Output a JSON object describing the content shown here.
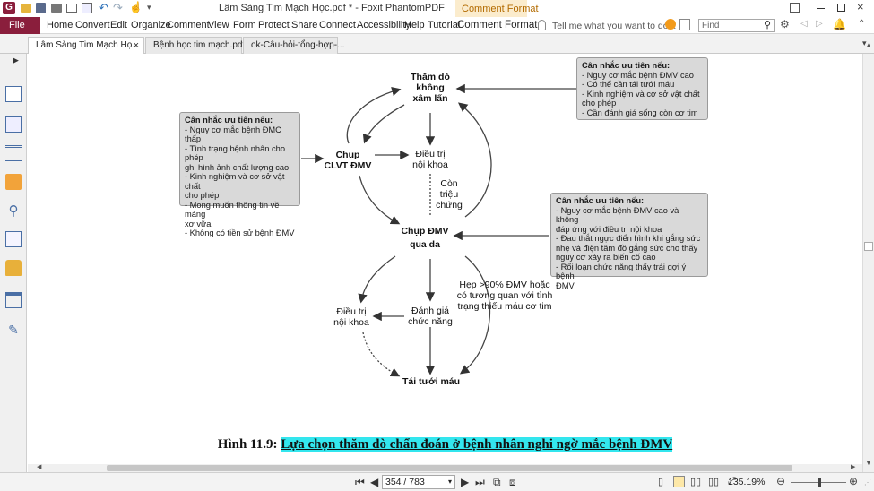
{
  "window": {
    "title": "Lâm Sàng Tim Mạch Học.pdf * - Foxit PhantomPDF",
    "context_tab": "Comment Format",
    "colors": {
      "file_button": "#8a1e3c",
      "context_tab_bg": "#fbeccd",
      "highlight": "#33e6ee"
    }
  },
  "menu": {
    "file": "File",
    "items": [
      "Home",
      "Convert",
      "Edit",
      "Organize",
      "Comment",
      "View",
      "Form",
      "Protect",
      "Share",
      "Connect",
      "Accessibility",
      "Help",
      "Tutorial",
      "Comment Format"
    ],
    "tell_me_placeholder": "Tell me what you want to do...",
    "find_placeholder": "Find"
  },
  "tabs": [
    {
      "label": "Lâm Sàng Tim Mạch Họ...",
      "close": "×"
    },
    {
      "label": "Bệnh học tim mạch.pdf",
      "close": ""
    },
    {
      "label": "ok-Câu-hỏi-tổng-hợp-...",
      "close": ""
    }
  ],
  "left_panel": {
    "icons": [
      "expand-arrow-icon",
      "bookmark-icon",
      "pages-icon",
      "layers-icon",
      "comments-icon",
      "attachments-icon",
      "signature-icon",
      "security-icon",
      "form-icon",
      "pen-icon"
    ]
  },
  "diagram": {
    "box_top_right": {
      "heading": "Cân nhắc ưu tiên nếu:",
      "lines": [
        "- Nguy cơ mắc bệnh ĐMV cao",
        "- Có thể cần tái tưới máu",
        "- Kinh nghiệm và cơ sở vật chất",
        "cho phép",
        "- Cần đánh giá sống còn cơ tim"
      ]
    },
    "box_left": {
      "heading": "Cân nhắc ưu tiên nếu:",
      "lines": [
        "- Nguy cơ mắc bệnh ĐMC thấp",
        "- Tình trạng bệnh nhân cho phép",
        "ghi hình ảnh chất lượng cao",
        "- Kinh nghiệm và cơ sở vật chất",
        "cho phép",
        "- Mong muốn thông tin về mảng",
        "xơ vữa",
        "- Không có tiền sử bệnh ĐMV"
      ]
    },
    "box_right": {
      "heading": "Cân nhắc ưu tiên nếu:",
      "lines": [
        "- Nguy cơ mắc bệnh ĐMV cao và không",
        "đáp ứng với điều trị nội khoa",
        "- Đau thắt ngực điển hình khi gắng sức",
        "nhẹ và điện tâm đồ gắng sức cho thấy",
        "nguy cơ xảy ra biến cố cao",
        "- Rối loạn chức năng thấy trái gợi ý bệnh",
        "ĐMV"
      ]
    },
    "nodes": {
      "noninvasive": [
        "Thăm dò",
        "không",
        "xâm lấn"
      ],
      "ct": [
        "Chụp",
        "CLVT ĐMV"
      ],
      "medical1": [
        "Điều trị",
        "nội khoa"
      ],
      "symptoms": [
        "Còn",
        "triệu",
        "chứng"
      ],
      "angio": [
        "Chụp ĐMV",
        "qua da"
      ],
      "stenosis": [
        "Hẹp >90% ĐMV hoặc",
        "có tương quan với tình",
        "trạng thiếu máu cơ tim"
      ],
      "medical2": [
        "Điều trị",
        "nội khoa"
      ],
      "functional": [
        "Đánh giá",
        "chức năng"
      ],
      "revasc": [
        "Tái tưới máu"
      ]
    },
    "caption_prefix": "Hình 11.9:",
    "caption_highlight": "Lựa chọn thăm dò chẩn đoán ở bệnh nhân nghi ngờ mắc bệnh ĐMV"
  },
  "status": {
    "page_display": "354 / 783",
    "zoom": "135.19%"
  }
}
